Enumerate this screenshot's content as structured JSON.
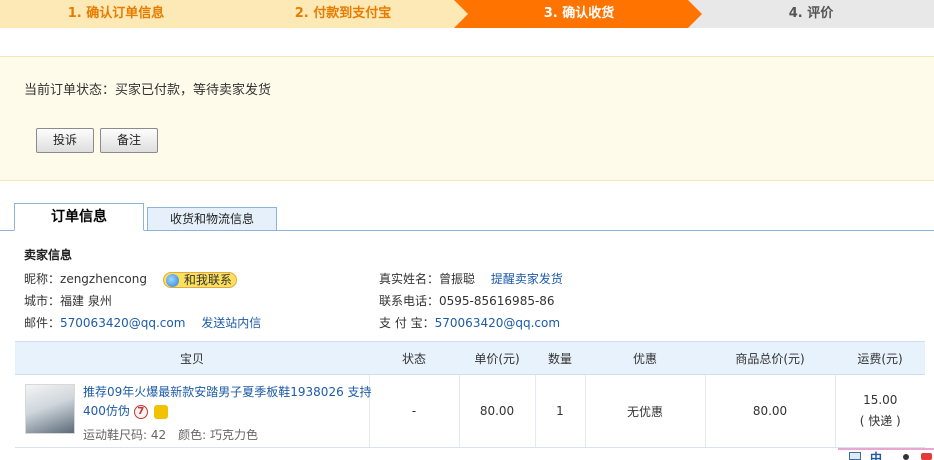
{
  "steps": [
    {
      "label": "1. 确认订单信息"
    },
    {
      "label": "2. 付款到支付宝"
    },
    {
      "label": "3. 确认收货"
    },
    {
      "label": "4. 评价"
    }
  ],
  "status": {
    "text": "当前订单状态：买家已付款，等待卖家发货",
    "complain_label": "投诉",
    "note_label": "备注"
  },
  "tabs": {
    "order_info": "订单信息",
    "shipping_info": "收货和物流信息"
  },
  "seller": {
    "section_title": "卖家信息",
    "nickname_label": "昵称：",
    "nickname": "zengzhencong",
    "contact_label": "和我联系",
    "city_label": "城市：",
    "city": "福建 泉州",
    "email_label": "邮件：",
    "email": "570063420@qq.com",
    "site_msg_label": "发送站内信",
    "realname_label": "真实姓名：",
    "realname": "曾振聪",
    "remind_label": "提醒卖家发货",
    "phone_label": "联系电话：",
    "phone": "0595-85616985-86",
    "alipay_label": "支 付 宝：",
    "alipay": "570063420@qq.com"
  },
  "table": {
    "headers": [
      "宝贝",
      "状态",
      "单价(元)",
      "数量",
      "优惠",
      "商品总价(元)",
      "运费(元)"
    ],
    "row": {
      "title": "推荐09年火爆最新款安踏男子夏季板鞋1938026 支持400仿伪",
      "badge_seven": "7",
      "attrs": "运动鞋尺码: 42　颜色: 巧克力色",
      "status": "-",
      "price": "80.00",
      "qty": "1",
      "discount": "无优惠",
      "total": "80.00",
      "shipping_fee": "15.00",
      "shipping_type": "( 快递 )"
    }
  },
  "floatbar": {
    "text": "中"
  },
  "colors": {
    "active_step": "#ff7300",
    "inactive_step": "#fde9b5",
    "link": "#1d5ba8"
  }
}
